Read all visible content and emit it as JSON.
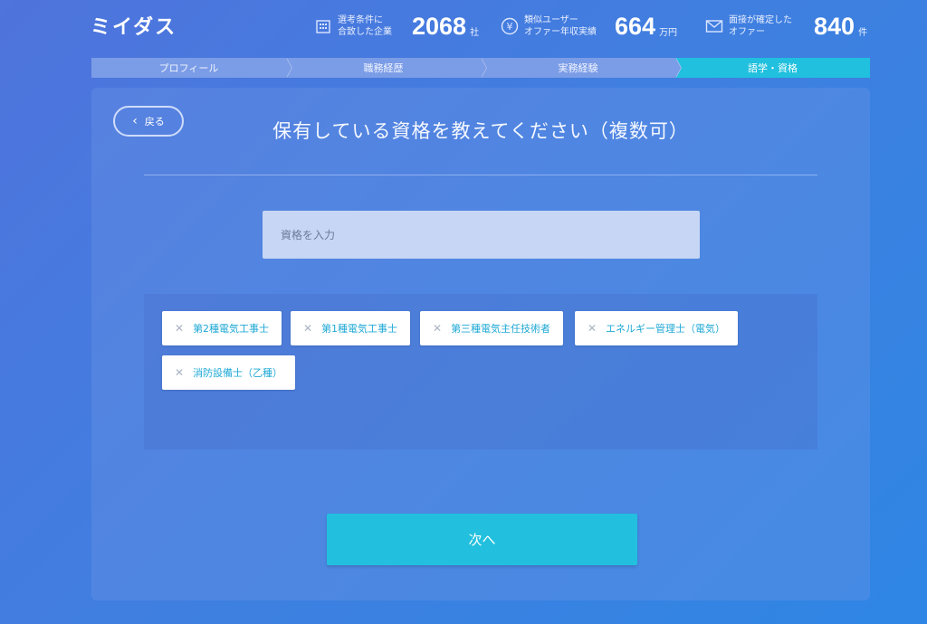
{
  "header": {
    "logo": "ミイダス",
    "stats": [
      {
        "icon": "building-icon",
        "label_line1": "選考条件に",
        "label_line2": "合致した企業",
        "value": "2068",
        "unit": "社"
      },
      {
        "icon": "yen-icon",
        "label_line1": "類似ユーザー",
        "label_line2": "オファー年収実績",
        "value": "664",
        "unit": "万円"
      },
      {
        "icon": "mail-icon",
        "label_line1": "面接が確定した",
        "label_line2": "オファー",
        "value": "840",
        "unit": "件"
      }
    ]
  },
  "steps": [
    {
      "label": "プロフィール"
    },
    {
      "label": "職務経歴"
    },
    {
      "label": "実務経験"
    },
    {
      "label": "語学・資格"
    }
  ],
  "active_step": "語学・資格",
  "card": {
    "back_label": "戻る",
    "title": "保有している資格を教えてください（複数可）",
    "input_placeholder": "資格を入力",
    "tags": [
      {
        "label": "第2種電気工事士"
      },
      {
        "label": "第1種電気工事士"
      },
      {
        "label": "第三種電気主任技術者"
      },
      {
        "label": "エネルギー管理士（電気）"
      },
      {
        "label": "消防設備士（乙種）"
      }
    ],
    "next_label": "次へ"
  },
  "colors": {
    "accent": "#22c0de",
    "tag_text": "#20a9d6",
    "step_inactive": "#7b9ce6"
  }
}
